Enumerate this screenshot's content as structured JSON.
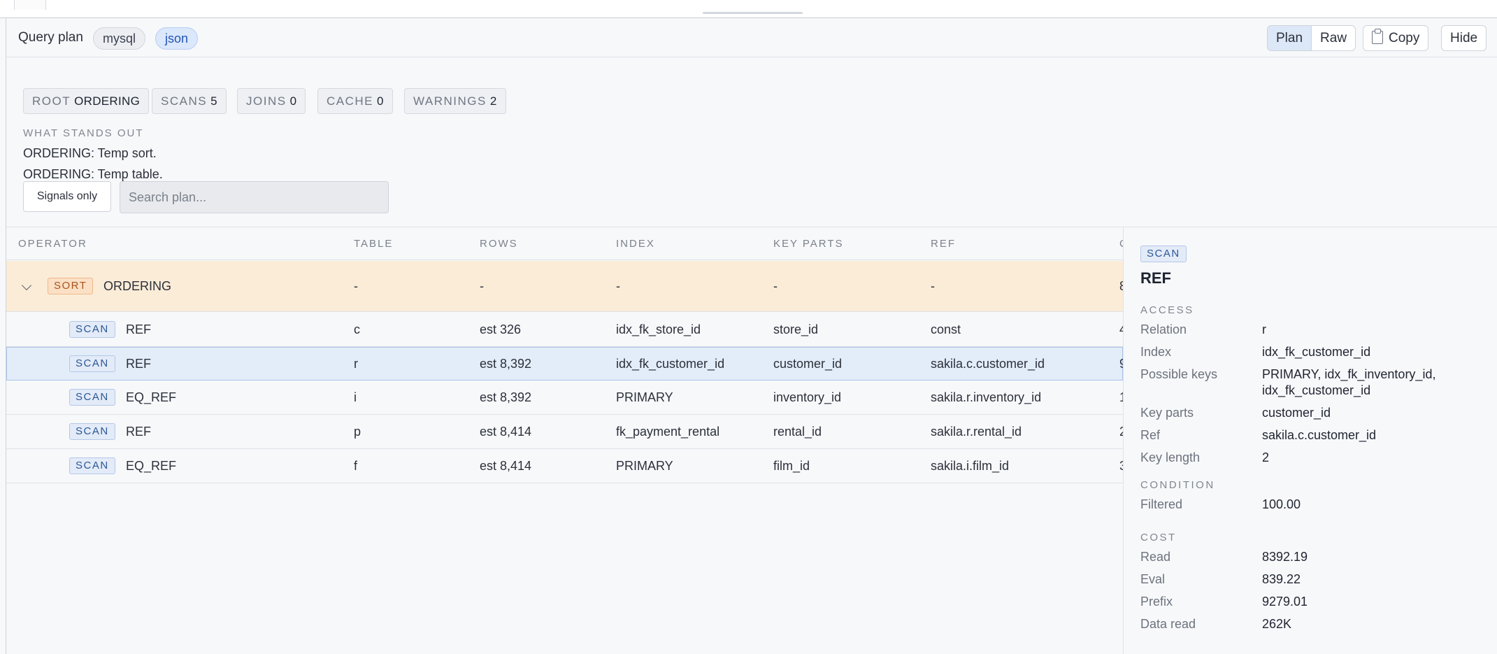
{
  "header": {
    "title": "Query plan",
    "formats": [
      "mysql",
      "json"
    ],
    "active_format": "json",
    "view_modes": [
      "Plan",
      "Raw"
    ],
    "active_view": "Plan",
    "copy_label": "Copy",
    "hide_label": "Hide"
  },
  "summary": {
    "chips": [
      {
        "label": "ROOT",
        "value": "ORDERING"
      },
      {
        "label": "SCANS",
        "value": "5"
      },
      {
        "label": "JOINS",
        "value": "0"
      },
      {
        "label": "CACHE",
        "value": "0"
      },
      {
        "label": "WARNINGS",
        "value": "2"
      }
    ],
    "standout_heading": "WHAT STANDS OUT",
    "standouts": [
      "ORDERING: Temp sort.",
      "ORDERING: Temp table."
    ],
    "signals_label": "Signals only",
    "search_placeholder": "Search plan..."
  },
  "table": {
    "columns": [
      "OPERATOR",
      "TABLE",
      "ROWS",
      "INDEX",
      "KEY PARTS",
      "REF",
      "C"
    ],
    "rows": [
      {
        "badge": "SORT",
        "operator": "ORDERING",
        "table": "-",
        "rows": "-",
        "index": "-",
        "key_parts": "-",
        "ref": "-",
        "cost": "8"
      },
      {
        "badge": "SCAN",
        "operator": "REF",
        "table": "c",
        "rows": "est 326",
        "index": "idx_fk_store_id",
        "key_parts": "store_id",
        "ref": "const",
        "cost": "4"
      },
      {
        "badge": "SCAN",
        "operator": "REF",
        "table": "r",
        "rows": "est 8,392",
        "index": "idx_fk_customer_id",
        "key_parts": "customer_id",
        "ref": "sakila.c.customer_id",
        "cost": "9"
      },
      {
        "badge": "SCAN",
        "operator": "EQ_REF",
        "table": "i",
        "rows": "est 8,392",
        "index": "PRIMARY",
        "key_parts": "inventory_id",
        "ref": "sakila.r.inventory_id",
        "cost": "1"
      },
      {
        "badge": "SCAN",
        "operator": "REF",
        "table": "p",
        "rows": "est 8,414",
        "index": "fk_payment_rental",
        "key_parts": "rental_id",
        "ref": "sakila.r.rental_id",
        "cost": "2"
      },
      {
        "badge": "SCAN",
        "operator": "EQ_REF",
        "table": "f",
        "rows": "est 8,414",
        "index": "PRIMARY",
        "key_parts": "film_id",
        "ref": "sakila.i.film_id",
        "cost": "3"
      }
    ]
  },
  "detail": {
    "badge": "SCAN",
    "title": "REF",
    "access_heading": "ACCESS",
    "access": [
      {
        "k": "Relation",
        "v": "r"
      },
      {
        "k": "Index",
        "v": "idx_fk_customer_id"
      },
      {
        "k": "Possible keys",
        "v": "PRIMARY, idx_fk_inventory_id, idx_fk_customer_id"
      },
      {
        "k": "Key parts",
        "v": "customer_id"
      },
      {
        "k": "Ref",
        "v": "sakila.c.customer_id"
      },
      {
        "k": "Key length",
        "v": "2"
      }
    ],
    "condition_heading": "CONDITION",
    "condition": [
      {
        "k": "Filtered",
        "v": "100.00"
      }
    ],
    "cost_heading": "COST",
    "cost": [
      {
        "k": "Read",
        "v": "8392.19"
      },
      {
        "k": "Eval",
        "v": "839.22"
      },
      {
        "k": "Prefix",
        "v": "9279.01"
      },
      {
        "k": "Data read",
        "v": "262K"
      }
    ]
  },
  "colors": {
    "accent": "#2356b8",
    "root_row": "#fbecd8",
    "selected_row": "#e3edf9"
  }
}
